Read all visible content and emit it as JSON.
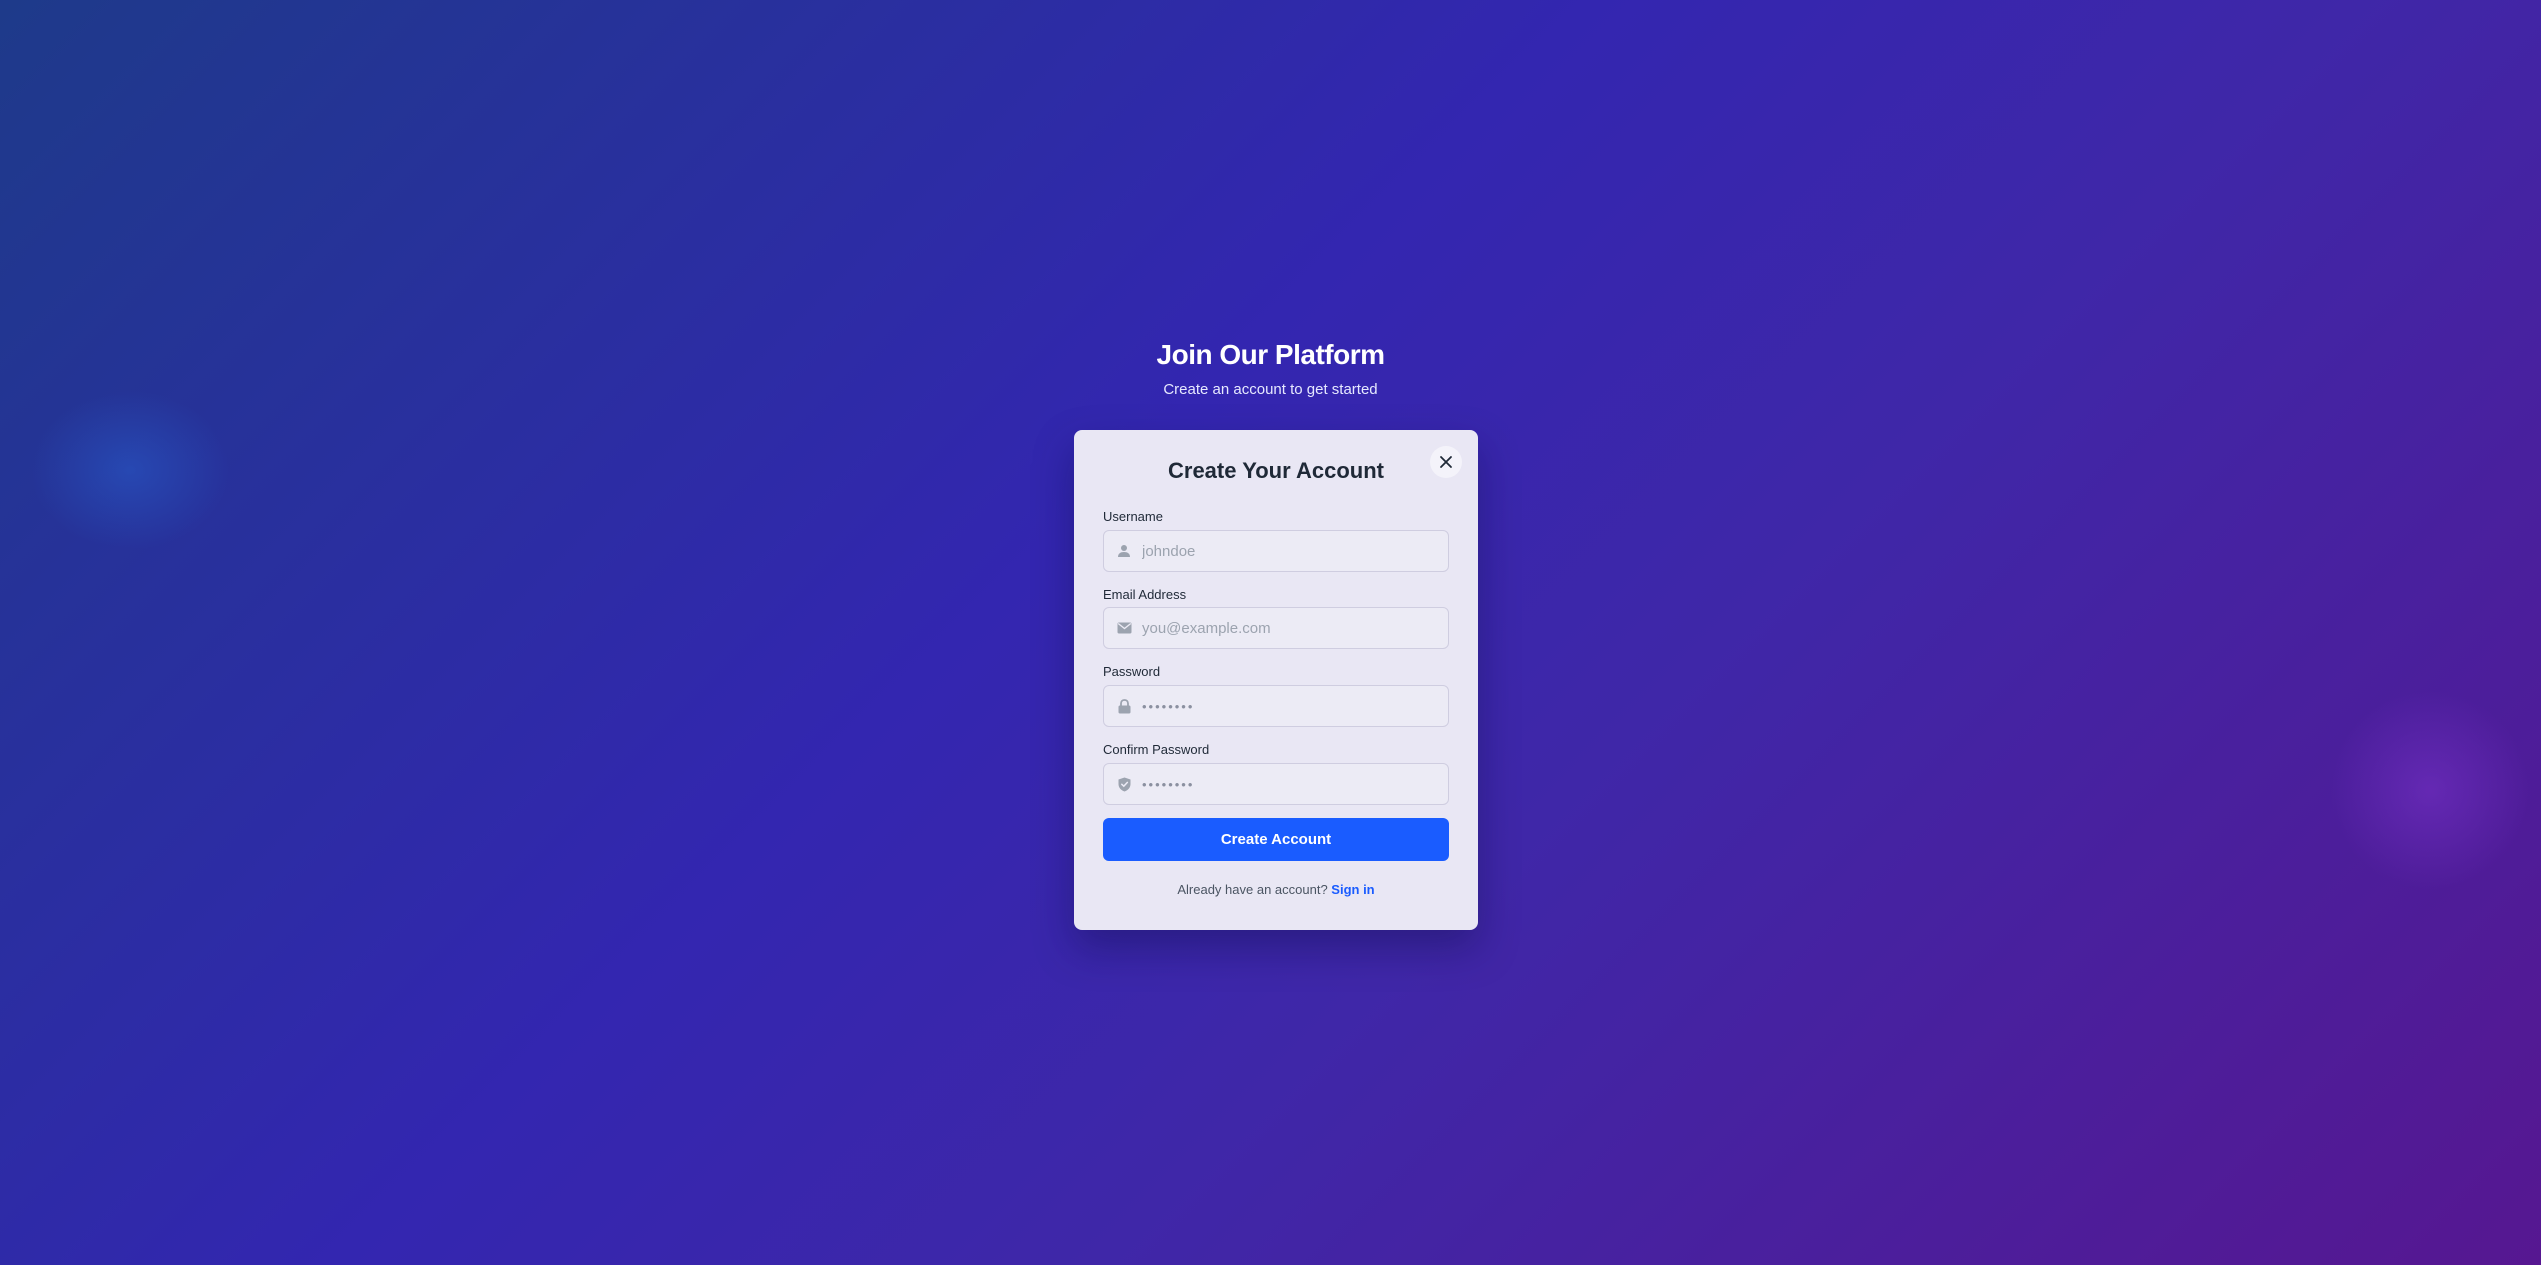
{
  "page": {
    "heading": "Join Our Platform",
    "subheading": "Create an account to get started"
  },
  "modal": {
    "title": "Create Your Account",
    "close_icon": "close-icon",
    "fields": {
      "username": {
        "label": "Username",
        "placeholder": "johndoe",
        "icon": "user-icon"
      },
      "email": {
        "label": "Email Address",
        "placeholder": "you@example.com",
        "icon": "mail-icon"
      },
      "password": {
        "label": "Password",
        "placeholder": "••••••••",
        "icon": "lock-icon"
      },
      "confirm_password": {
        "label": "Confirm Password",
        "placeholder": "••••••••",
        "icon": "shield-check-icon"
      }
    },
    "submit_label": "Create Account",
    "footer_text": "Already have an account?",
    "signin_link": "Sign in"
  },
  "colors": {
    "accent": "#1a5cff",
    "card_background": "#e9e7f4",
    "background_start": "#1e3a8a",
    "background_end": "#561791"
  }
}
